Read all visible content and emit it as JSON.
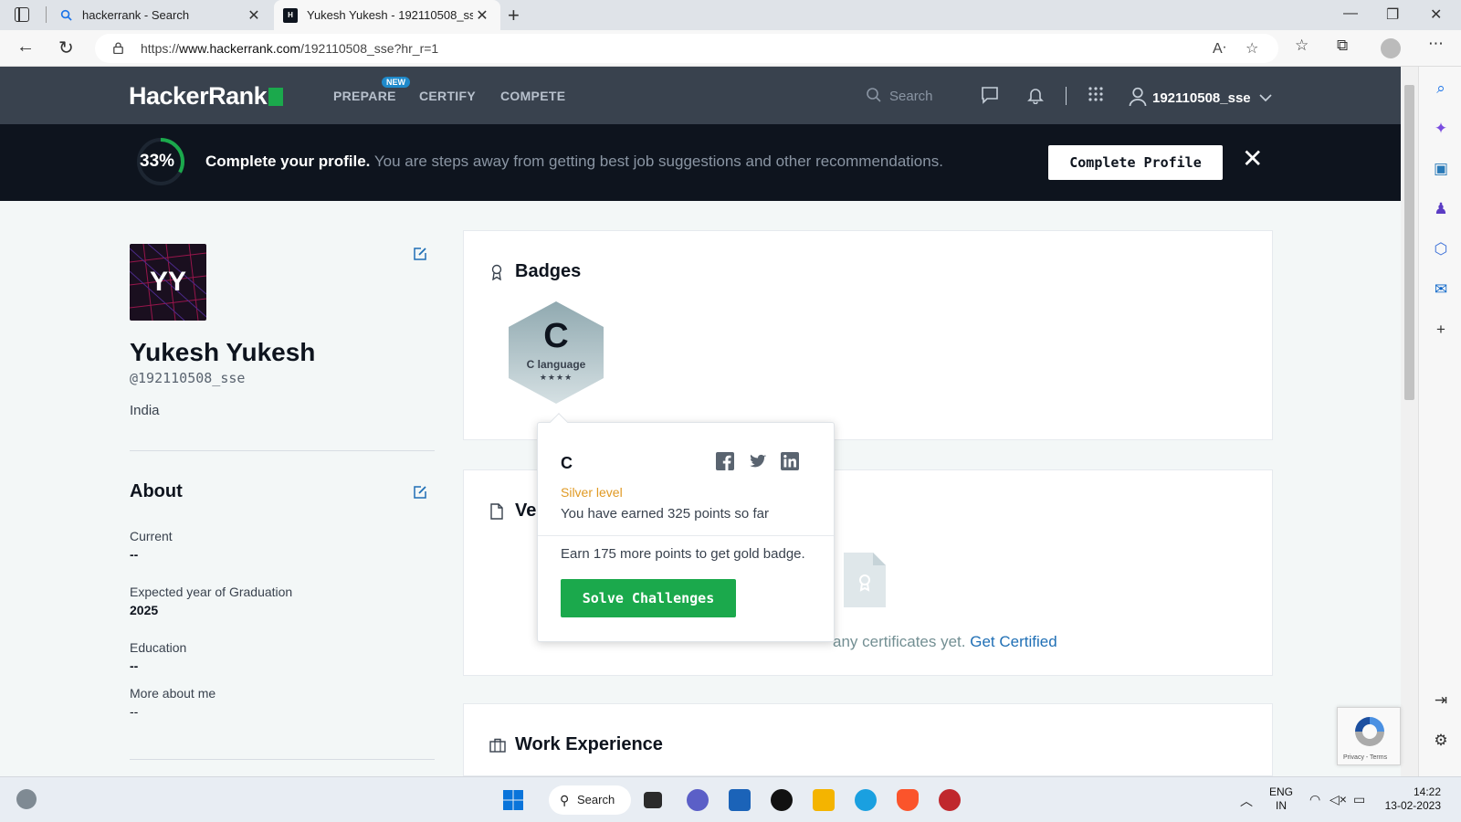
{
  "browser": {
    "tabs": [
      {
        "label": "hackerrank - Search",
        "active": false
      },
      {
        "label": "Yukesh Yukesh - 192110508_sse",
        "active": true
      }
    ],
    "url_prefix": "https://",
    "url_domain": "www.hackerrank.com",
    "url_path": "/192110508_sse?hr_r=1"
  },
  "hr_header": {
    "logo": "HackerRank",
    "nav": [
      "PREPARE",
      "CERTIFY",
      "COMPETE"
    ],
    "new_badge": "NEW",
    "search_placeholder": "Search",
    "username": "192110508_sse"
  },
  "banner": {
    "percent": "33%",
    "percent_value": 0.33,
    "headline": "Complete your profile.",
    "text": " You are steps away from getting best job suggestions and other recommendations.",
    "button": "Complete Profile"
  },
  "profile": {
    "initials": "YY",
    "name": "Yukesh Yukesh",
    "handle": "@192110508_sse",
    "country": "India",
    "about_title": "About",
    "fields": [
      {
        "label": "Current",
        "value": "--"
      },
      {
        "label": "Expected year of Graduation",
        "value": "2025"
      },
      {
        "label": "Education",
        "value": "--"
      },
      {
        "label": "More about me",
        "value": "--"
      }
    ]
  },
  "badges": {
    "title": "Badges",
    "items": [
      {
        "letter": "C",
        "name": "C language",
        "stars": "★★★★"
      }
    ]
  },
  "certificates": {
    "title_visible": "Ve",
    "empty_text": "any certificates yet. ",
    "link": "Get Certified"
  },
  "work": {
    "title": "Work Experience"
  },
  "popover": {
    "title": "C",
    "level": "Silver level",
    "points_text": "You have earned 325 points so far",
    "earn_text": "Earn 175 more points to get gold badge.",
    "button": "Solve Challenges"
  },
  "recaptcha": {
    "terms": "Privacy - Terms"
  },
  "taskbar": {
    "search": "Search",
    "lang": "ENG",
    "region": "IN",
    "time": "14:22",
    "date": "13-02-2023"
  },
  "colors": {
    "hr_green": "#1ba94c",
    "hr_dark": "#0e141e",
    "hr_nav": "#39424e",
    "silver_level": "#e09a24",
    "link_blue": "#1f6fb5"
  }
}
